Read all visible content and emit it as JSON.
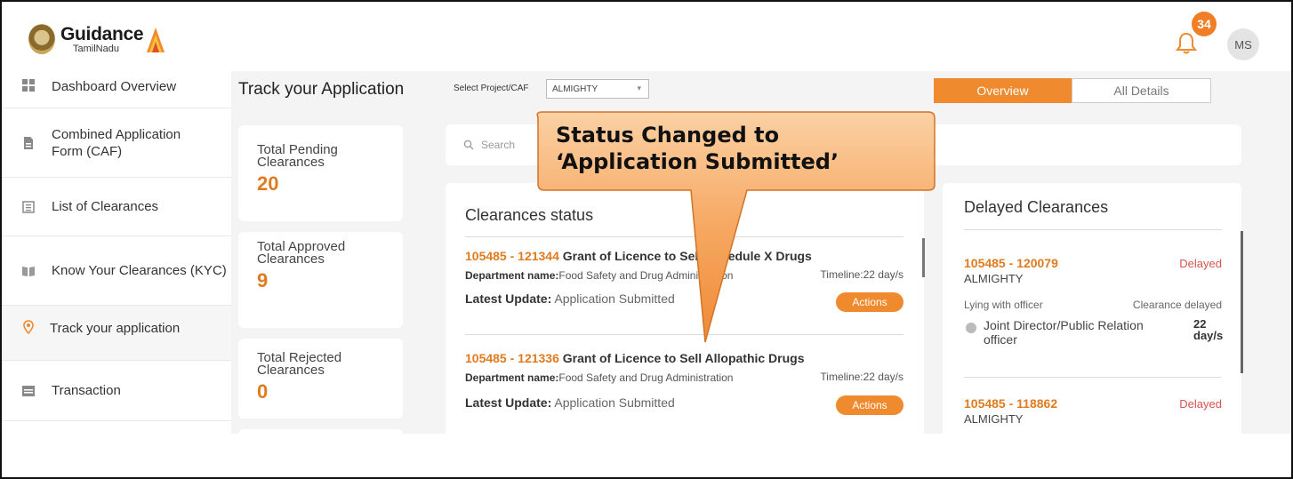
{
  "header": {
    "logo_main": "Guidance",
    "logo_sub": "TamilNadu",
    "notification_count": "34",
    "avatar_initials": "MS"
  },
  "sidebar": {
    "items": [
      {
        "label": "Dashboard Overview",
        "icon": "grid-icon"
      },
      {
        "label": "Combined Application Form (CAF)",
        "icon": "document-icon"
      },
      {
        "label": "List of Clearances",
        "icon": "list-icon"
      },
      {
        "label": "Know Your Clearances (KYC)",
        "icon": "book-icon"
      },
      {
        "label": "Track your application",
        "icon": "location-pin-icon",
        "active": true
      },
      {
        "label": "Transaction",
        "icon": "transaction-icon"
      }
    ]
  },
  "main": {
    "title": "Track your Application",
    "project_label": "Select Project/CAF",
    "project_value": "ALMIGHTY",
    "tabs": [
      {
        "label": "Overview",
        "active": true
      },
      {
        "label": "All Details",
        "active": false
      }
    ],
    "stats": [
      {
        "label": "Total Pending Clearances",
        "value": "20"
      },
      {
        "label": "Total Approved Clearances",
        "value": "9"
      },
      {
        "label": "Total Rejected Clearances",
        "value": "0"
      }
    ],
    "search_placeholder": "Search",
    "clearances_status": {
      "title": "Clearances status",
      "items": [
        {
          "id": "105485 - 121344",
          "name": "Grant of Licence to Sell Schedule X Drugs",
          "dept_label": "Department name:",
          "dept": "Food Safety and Drug Administration",
          "timeline": "Timeline:22 day/s",
          "update_label": "Latest Update:",
          "update": "Application Submitted",
          "action": "Actions"
        },
        {
          "id": "105485 - 121336",
          "name": "Grant of Licence to Sell Allopathic Drugs",
          "dept_label": "Department name:",
          "dept": "Food Safety and Drug Administration",
          "timeline": "Timeline:22 day/s",
          "update_label": "Latest Update:",
          "update": "Application Submitted",
          "action": "Actions"
        }
      ]
    },
    "delayed": {
      "title": "Delayed Clearances",
      "items": [
        {
          "id": "105485 - 120079",
          "status": "Delayed",
          "project": "ALMIGHTY",
          "lying_label": "Lying with officer",
          "delay_label": "Clearance delayed",
          "officer": "Joint Director/Public Relation officer",
          "days": "22 day/s"
        },
        {
          "id": "105485 - 118862",
          "status": "Delayed",
          "project": "ALMIGHTY"
        }
      ]
    }
  },
  "callout": {
    "line1": "Status Changed to",
    "line2": "‘Application Submitted’"
  },
  "colors": {
    "accent": "#ef8a2e",
    "delayed": "#d9534f"
  }
}
